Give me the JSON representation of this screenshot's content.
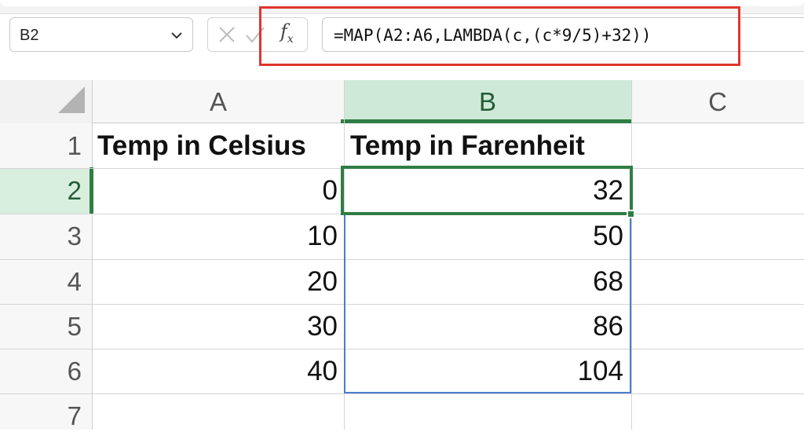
{
  "name_box": {
    "value": "B2"
  },
  "formula_bar": {
    "formula": "=MAP(A2:A6,LAMBDA(c,(c*9/5)+32))",
    "fx_label": "f",
    "fx_sub": "x"
  },
  "columns": [
    "A",
    "B",
    "C"
  ],
  "rows": [
    "1",
    "2",
    "3",
    "4",
    "5",
    "6",
    "7"
  ],
  "cells": {
    "a1": "Temp in Celsius",
    "b1": "Temp in Farenheit",
    "a2": "0",
    "b2": "32",
    "a3": "10",
    "b3": "50",
    "a4": "20",
    "b4": "68",
    "a5": "30",
    "b5": "86",
    "a6": "40",
    "b6": "104"
  },
  "colors": {
    "selection_green": "#2f7d43",
    "spill_blue": "#4a7bd0",
    "annotation_red": "#e0352b"
  }
}
